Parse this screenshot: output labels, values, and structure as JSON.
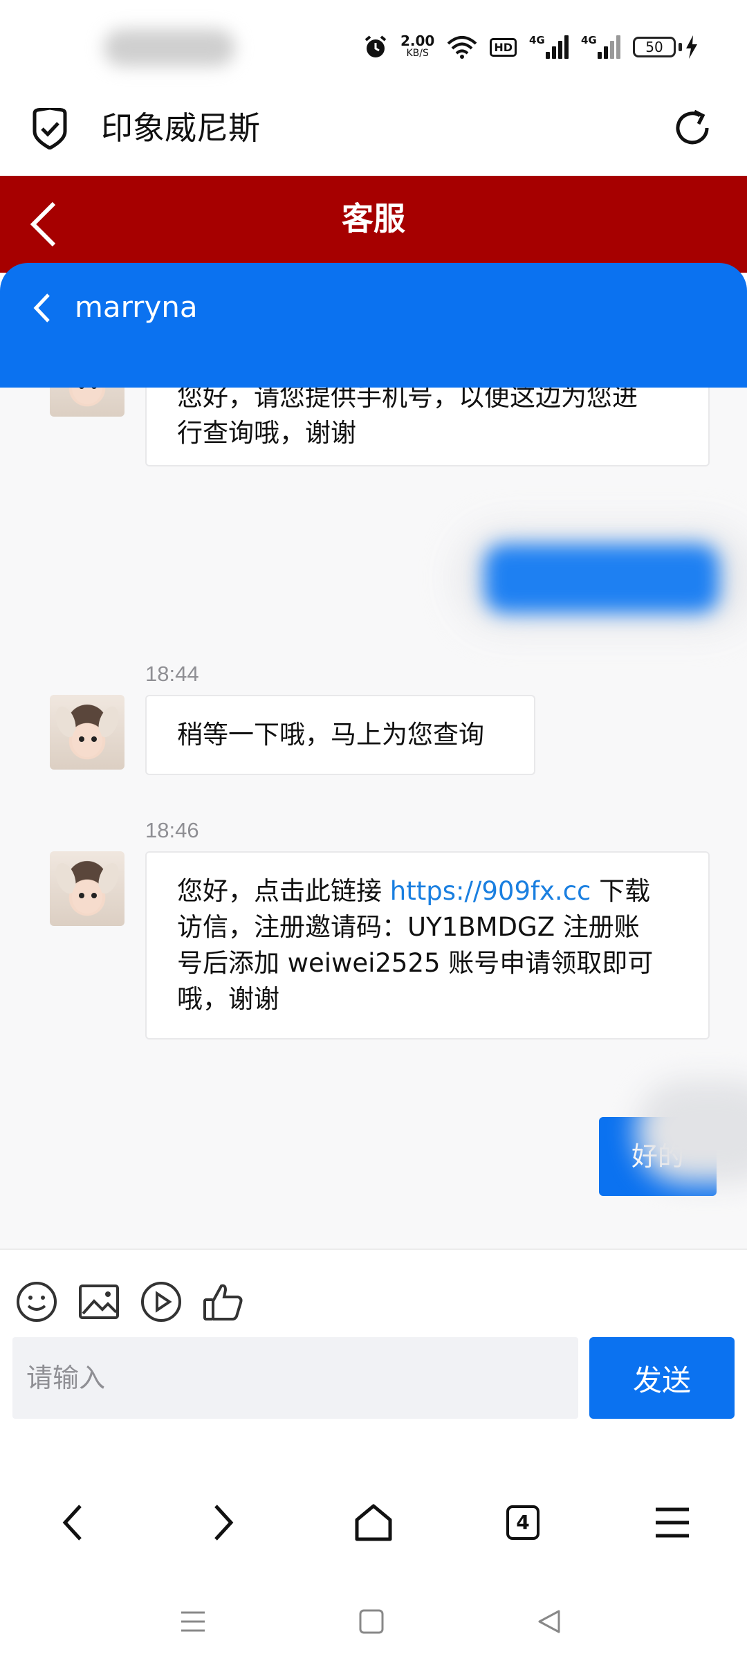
{
  "status_bar": {
    "speed_value": "2.00",
    "speed_unit": "KB/S",
    "hd_label": "HD",
    "net1": "4G",
    "net2": "4G",
    "battery": "50"
  },
  "browser": {
    "site_title": "印象威尼斯"
  },
  "page_header": {
    "title": "客服"
  },
  "chat_header": {
    "agent_name": "marryna"
  },
  "messages": [
    {
      "line1": "您好，请您提供手机号，以便这边为您进",
      "line2": "行查询哦，谢谢"
    },
    {
      "time": "18:44",
      "text": "稍等一下哦，马上为您查询"
    },
    {
      "time": "18:46",
      "line1_pre": "您好，点击此链接 ",
      "link": "https://909fx.cc",
      "line1_post": " 下载",
      "line2": "访信，注册邀请码：UY1BMDGZ 注册账",
      "line3": "号后添加 weiwei2525 账号申请领取即可",
      "line4": "哦，谢谢"
    }
  ],
  "my_reply": "好的",
  "input": {
    "placeholder": "请输入",
    "send_label": "发送"
  },
  "nav": {
    "tab_count": "4"
  },
  "icons": [
    "alarm-icon",
    "wifi-icon",
    "shield-check-icon",
    "refresh-icon",
    "back-icon",
    "emoji-icon",
    "image-icon",
    "video-icon",
    "thumbs-up-icon",
    "home-icon",
    "menu-icon"
  ],
  "colors": {
    "header_red": "#a60000",
    "chat_blue": "#0b72f0",
    "link_blue": "#1a7fe0"
  }
}
